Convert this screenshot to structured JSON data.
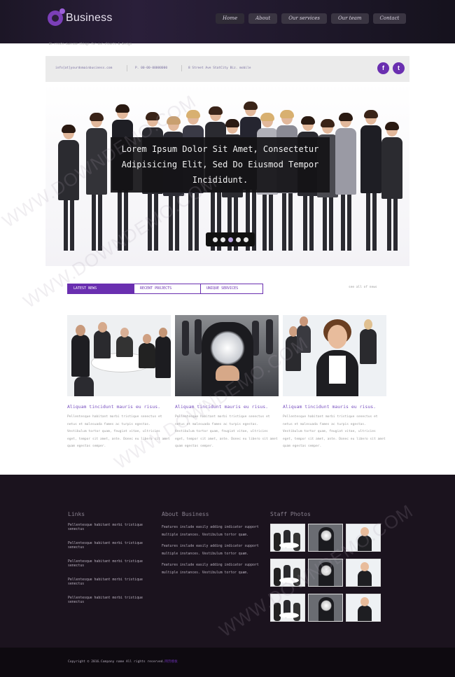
{
  "header": {
    "logo_text": "Business",
    "nav": [
      "Home",
      "About",
      "Our services",
      "Our team",
      "Contact"
    ]
  },
  "breadcrumb": "We create awesome things for our clients & design",
  "infobar": {
    "email": "info[at]yourdomainbusiness.com",
    "phone": "P. 00-00-00000000",
    "address": "8 Street Ave StatCity Biz. mobile",
    "social": [
      "f",
      "t"
    ]
  },
  "hero": {
    "caption": "Lorem Ipsum Dolor Sit Amet, Consectetur Adipisicing Elit, Sed Do Eiusmod Tempor Incididunt.",
    "slides": 5,
    "active_slide": 2
  },
  "tabs": {
    "items": [
      "LATEST NEWS",
      "RECENT PROJECTS",
      "UNIQUE SERVICES"
    ],
    "see_all": "see all of news"
  },
  "cards": [
    {
      "title": "Aliquam tincidunt mauris eu risus.",
      "text": "Pellentesque habitant morbi tristique senectus et netus et malesuada fames ac turpis egestas. Vestibulum tortor quam, feugiat vitae, ultricies eget, tempor sit amet, ante. Donec eu libero sit amet quam egestas semper."
    },
    {
      "title": "Aliquam tincidunt mauris eu risus.",
      "text": "Pellentesque habitant morbi tristique senectus et netus et malesuada fames ac turpis egestas. Vestibulum tortor quam, feugiat vitae, ultricies eget, tempor sit amet, ante. Donec eu libero sit amet quam egestas semper."
    },
    {
      "title": "Aliquam tincidunt mauris eu risus.",
      "text": "Pellentesque habitant morbi tristique senectus et netus et malesuada fames ac turpis egestas. Vestibulum tortor quam, feugiat vitae, ultricies eget, tempor sit amet, ante. Donec eu libero sit amet quam egestas semper."
    }
  ],
  "footer": {
    "links_title": "Links",
    "links": [
      "Pellentesque habitant morbi tristique senectus",
      "Pellentesque habitant morbi tristique senectus",
      "Pellentesque habitant morbi tristique senectus",
      "Pellentesque habitant morbi tristique senectus",
      "Pellentesque habitant morbi tristique senectus"
    ],
    "about_title": "About Business",
    "about": [
      "Features include easily adding indicator support multiple instances. Vestibulum tortor quam.",
      "Features include easily adding indicator support multiple instances. Vestibulum tortor quam.",
      "Features include easily adding indicator support multiple instances. Vestibulum tortor quam."
    ],
    "photos_title": "Staff Photos",
    "photo_count": 9
  },
  "copyright": {
    "text": "Copyright © 2016.Company name All rights reserved.",
    "link": "网页模板"
  },
  "watermark": "WWW.DOWNDEMO.COM",
  "colors": {
    "accent": "#6a2fb0",
    "header_bg": "#1c1626",
    "footer_bg": "#1b131e"
  }
}
